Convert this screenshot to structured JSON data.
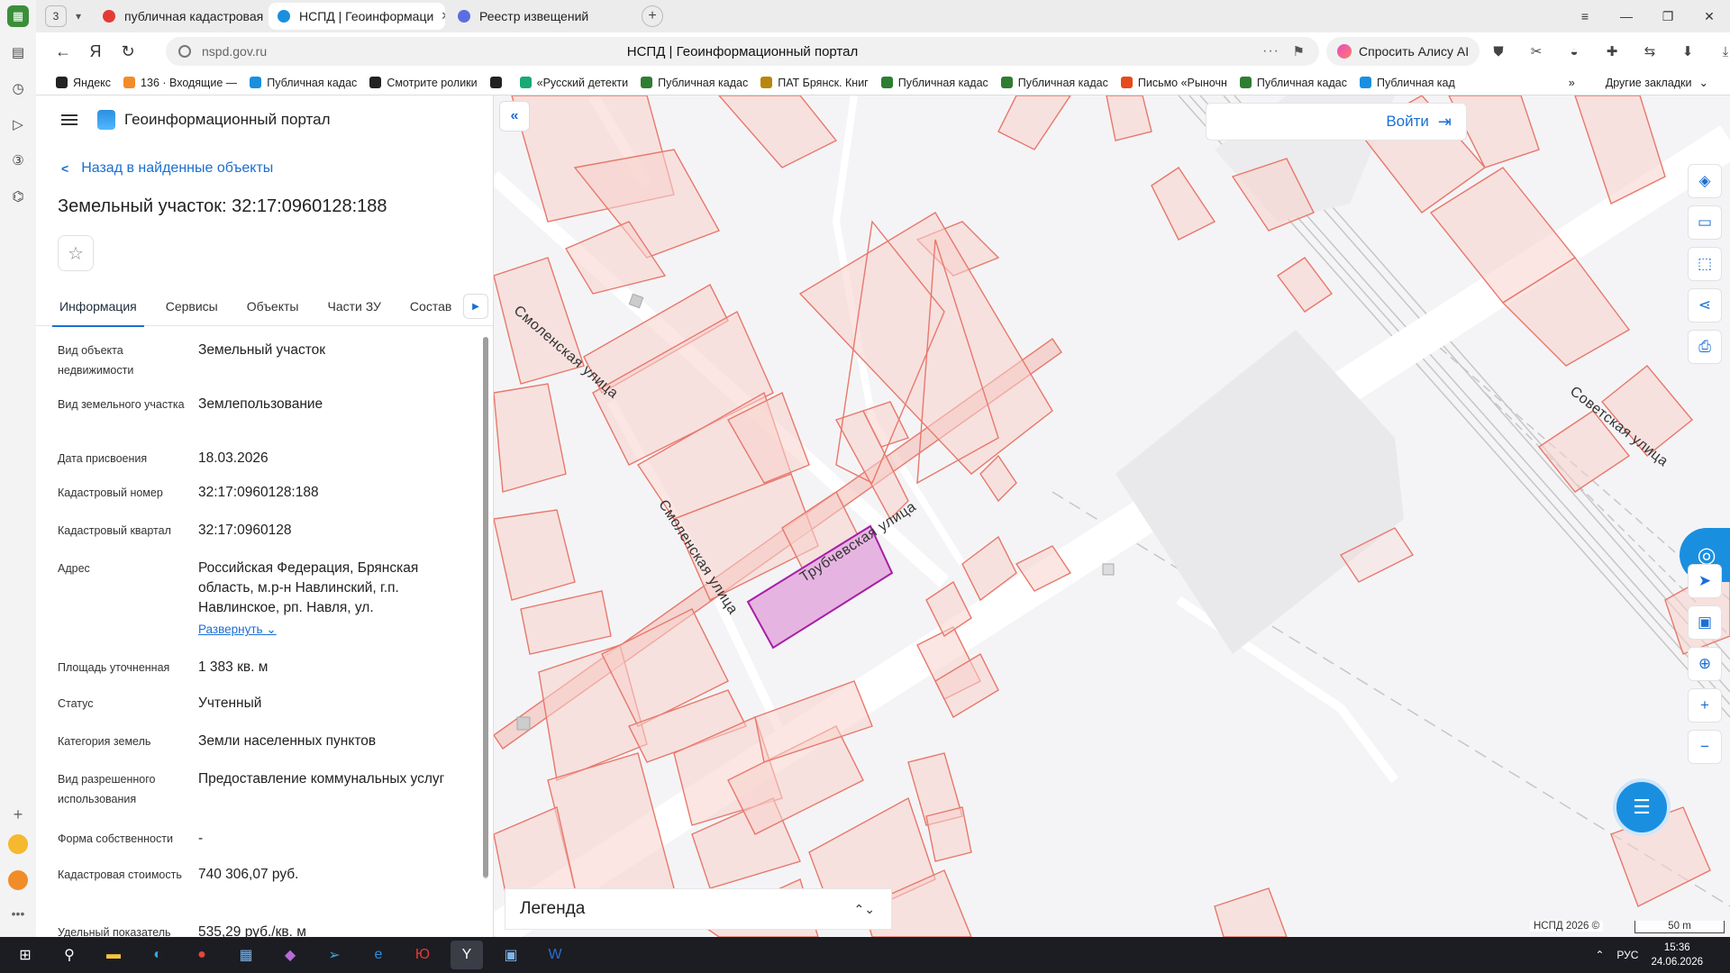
{
  "browser": {
    "tab_count": "3",
    "tabs": [
      {
        "label": "публичная кадастровая к",
        "fav_color": "#e53935",
        "active": false
      },
      {
        "label": "НСПД | Геоинформаци",
        "fav_color": "#1a8fe0",
        "active": true
      },
      {
        "label": "Реестр извещений",
        "fav_color": "#5b6ee1",
        "active": false
      }
    ],
    "url": "nspd.gov.ru",
    "page_title": "НСПД | Геоинформационный портал",
    "alice_label": "Спросить Алису AI",
    "bookmarks": [
      {
        "label": "Яндекс",
        "color": "#222"
      },
      {
        "label": "136 · Входящие —",
        "color": "#f28c28"
      },
      {
        "label": "Публичная кадас",
        "color": "#1a8fe0"
      },
      {
        "label": "Смотрите ролики",
        "color": "#222"
      },
      {
        "label": "",
        "color": "#222"
      },
      {
        "label": "«Русский детекти",
        "color": "#19a974"
      },
      {
        "label": "Публичная кадас",
        "color": "#2e7d32"
      },
      {
        "label": "ПАТ Брянск. Книг",
        "color": "#b8860b"
      },
      {
        "label": "Публичная кадас",
        "color": "#2e7d32"
      },
      {
        "label": "Публичная кадас",
        "color": "#2e7d32"
      },
      {
        "label": "Письмо «Рыночн",
        "color": "#e64a19"
      },
      {
        "label": "Публичная кадас",
        "color": "#2e7d32"
      },
      {
        "label": "Публичная кад",
        "color": "#1a8fe0"
      }
    ],
    "other_bookmarks": "Другие закладки"
  },
  "panel": {
    "portal_title": "Геоинформационный портал",
    "back_link": "Назад в найденные объекты",
    "object_title": "Земельный участок: 32:17:0960128:188",
    "tabs": [
      "Информация",
      "Сервисы",
      "Объекты",
      "Части ЗУ",
      "Состав"
    ],
    "properties": [
      {
        "key": "Вид объекта недвижимости",
        "value": "Земельный участок"
      },
      {
        "key": "Вид земельного участка",
        "value": "Землепользование"
      },
      {
        "key": "Дата присвоения",
        "value": "18.03.2026"
      },
      {
        "key": "Кадастровый номер",
        "value": "32:17:0960128:188"
      },
      {
        "key": "Кадастровый квартал",
        "value": "32:17:0960128"
      },
      {
        "key": "Адрес",
        "value": "Российская Федерация, Брянская область, м.р-н Навлинский, г.п. Навлинское, рп. Навля, ул."
      },
      {
        "key": "Площадь уточненная",
        "value": "1 383 кв. м"
      },
      {
        "key": "Статус",
        "value": "Учтенный"
      },
      {
        "key": "Категория земель",
        "value": "Земли населенных пунктов"
      },
      {
        "key": "Вид разрешенного использования",
        "value": "Предоставление коммунальных услуг"
      },
      {
        "key": "Форма собственности",
        "value": "-"
      },
      {
        "key": "Кадастровая стоимость",
        "value": "740 306,07 руб."
      },
      {
        "key": "Удельный показатель",
        "value": "535,29 руб./кв. м"
      }
    ],
    "expand_label": "Развернуть"
  },
  "map": {
    "login_label": "Войти",
    "legend_label": "Легенда",
    "attribution": "НСПД 2026 ©",
    "scale_label": "50 m",
    "street_labels": [
      "Смоленская улица",
      "Смоленская улица",
      "Трубчевская улица",
      "Советская улица"
    ],
    "parcel_stroke": "#e8786b",
    "parcel_fill": "#f7cfc9",
    "selected_stroke": "#a61fa6",
    "selected_fill": "#e6b4e0"
  },
  "taskbar": {
    "lang": "РУС",
    "time": "15:36",
    "date": "24.06.2026"
  }
}
